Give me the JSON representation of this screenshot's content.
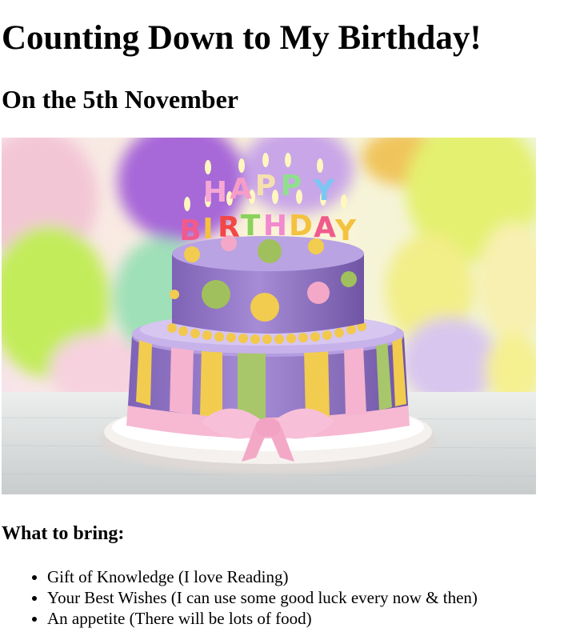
{
  "page": {
    "title": "Counting Down to My Birthday!",
    "subtitle": "On the 5th November"
  },
  "image": {
    "subject": "birthday-cake",
    "candle_letters": [
      "H",
      "A",
      "P",
      "P",
      "Y",
      "B",
      "I",
      "R",
      "T",
      "H",
      "D",
      "A",
      "Y"
    ],
    "colors": {
      "cake_purple": "#9a7ccc",
      "stripe_yellow": "#f2cc4e",
      "stripe_green": "#a8c66a",
      "stripe_pink": "#f5b3cf",
      "ribbon_pink": "#f7b8d2",
      "board_white": "#f4f1ee"
    }
  },
  "bring": {
    "heading": "What to bring:",
    "items": [
      "Gift of Knowledge (I love Reading)",
      "Your Best Wishes (I can use some good luck every now & then)",
      "An appetite (There will be lots of food)"
    ]
  }
}
